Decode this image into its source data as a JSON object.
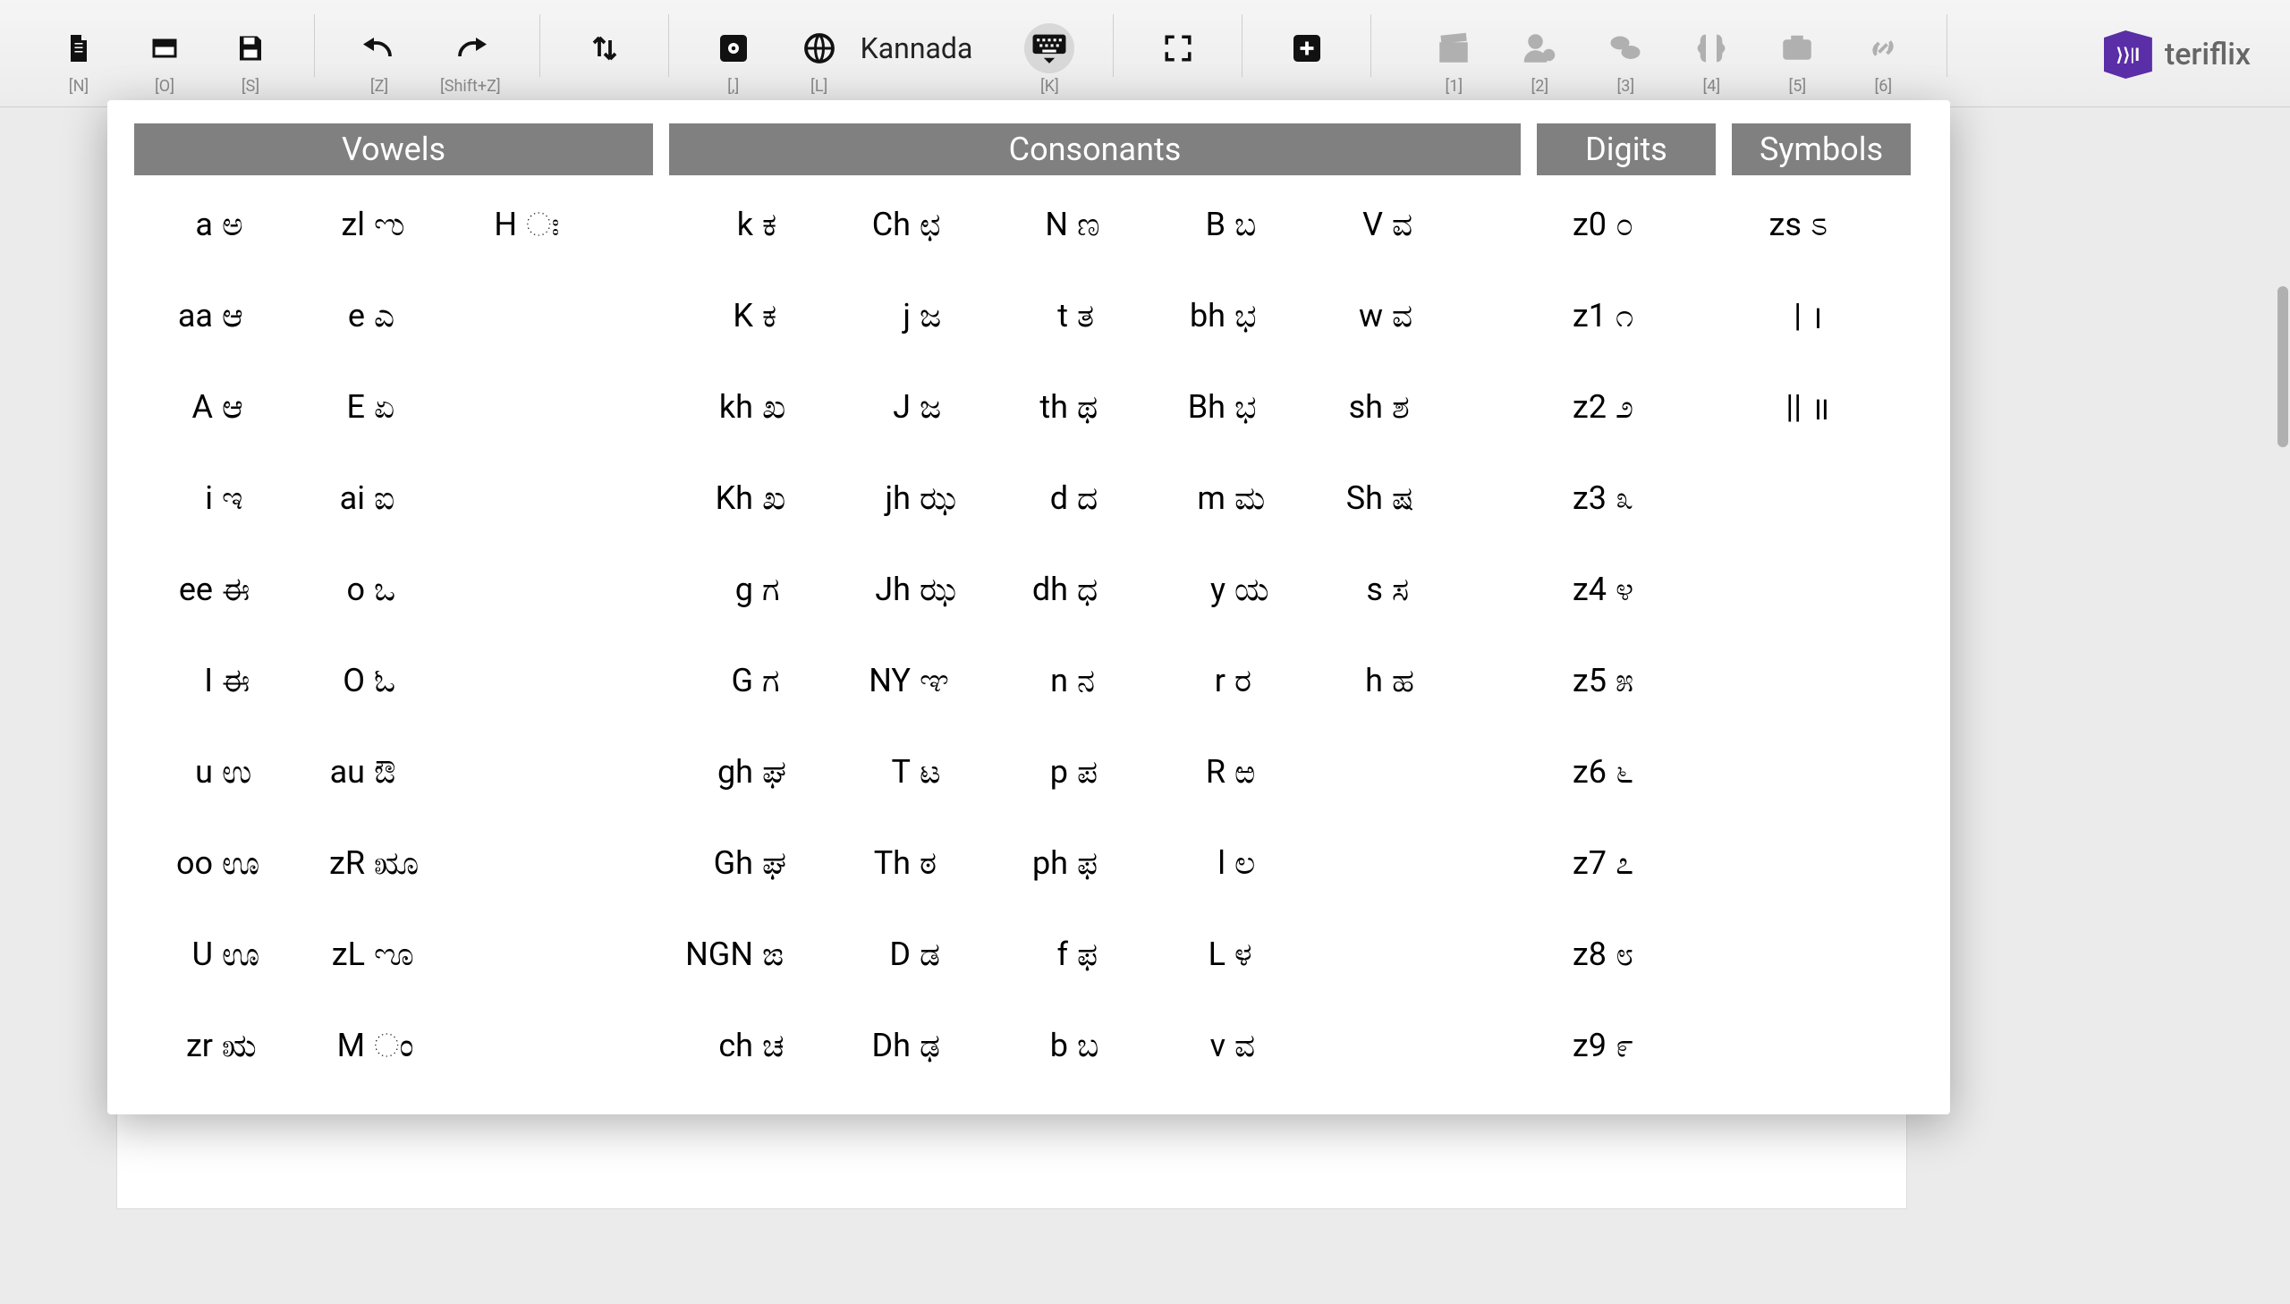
{
  "toolbar": {
    "new_sc": "[N]",
    "open_sc": "[O]",
    "save_sc": "[S]",
    "undo_sc": "[Z]",
    "redo_sc": "[Shift+Z]",
    "settings_sc": "[,]",
    "lang_label": "Kannada",
    "lang_sc": "[L]",
    "kbd_sc": "[K]",
    "slate_sc": "[1]",
    "user_sc": "[2]",
    "chat_sc": "[3]",
    "braces_sc": "[4]",
    "camera_sc": "[5]",
    "link_sc": "[6]"
  },
  "logo": {
    "text": "teriflix",
    "mark": "⟩⟩|I"
  },
  "headers": {
    "vowels": "Vowels",
    "consonants": "Consonants",
    "digits": "Digits",
    "symbols": "Symbols"
  },
  "vowels": {
    "col1": [
      {
        "l": "a",
        "g": "ಅ"
      },
      {
        "l": "aa",
        "g": "ಆ"
      },
      {
        "l": "A",
        "g": "ಆ"
      },
      {
        "l": "i",
        "g": "ಇ"
      },
      {
        "l": "ee",
        "g": "ಈ"
      },
      {
        "l": "I",
        "g": "ಈ"
      },
      {
        "l": "u",
        "g": "ಉ"
      },
      {
        "l": "oo",
        "g": "ಊ"
      },
      {
        "l": "U",
        "g": "ಊ"
      },
      {
        "l": "zr",
        "g": "ಋ"
      }
    ],
    "col2": [
      {
        "l": "zl",
        "g": "ಌ"
      },
      {
        "l": "e",
        "g": "ಎ"
      },
      {
        "l": "E",
        "g": "ಏ"
      },
      {
        "l": "ai",
        "g": "ಐ"
      },
      {
        "l": "o",
        "g": "ಒ"
      },
      {
        "l": "O",
        "g": "ಓ"
      },
      {
        "l": "au",
        "g": "ಔ"
      },
      {
        "l": "zR",
        "g": "ೠ"
      },
      {
        "l": "zL",
        "g": "ೡ"
      },
      {
        "l": "M",
        "g": "ಂ"
      }
    ],
    "col3": [
      {
        "l": "H",
        "g": "ಃ"
      }
    ]
  },
  "consonants": {
    "col1": [
      {
        "l": "k",
        "g": "ಕ"
      },
      {
        "l": "K",
        "g": "ಕ"
      },
      {
        "l": "kh",
        "g": "ಖ"
      },
      {
        "l": "Kh",
        "g": "ಖ"
      },
      {
        "l": "g",
        "g": "ಗ"
      },
      {
        "l": "G",
        "g": "ಗ"
      },
      {
        "l": "gh",
        "g": "ಘ"
      },
      {
        "l": "Gh",
        "g": "ಘ"
      },
      {
        "l": "NGN",
        "g": "ಙ"
      },
      {
        "l": "ch",
        "g": "ಚ"
      }
    ],
    "col2": [
      {
        "l": "Ch",
        "g": "ಛ"
      },
      {
        "l": "j",
        "g": "ಜ"
      },
      {
        "l": "J",
        "g": "ಜ"
      },
      {
        "l": "jh",
        "g": "ಝ"
      },
      {
        "l": "Jh",
        "g": "ಝ"
      },
      {
        "l": "NY",
        "g": "ಞ"
      },
      {
        "l": "T",
        "g": "ಟ"
      },
      {
        "l": "Th",
        "g": "ಠ"
      },
      {
        "l": "D",
        "g": "ಡ"
      },
      {
        "l": "Dh",
        "g": "ಢ"
      }
    ],
    "col3": [
      {
        "l": "N",
        "g": "ಣ"
      },
      {
        "l": "t",
        "g": "ತ"
      },
      {
        "l": "th",
        "g": "ಥ"
      },
      {
        "l": "d",
        "g": "ದ"
      },
      {
        "l": "dh",
        "g": "ಧ"
      },
      {
        "l": "n",
        "g": "ನ"
      },
      {
        "l": "p",
        "g": "ಪ"
      },
      {
        "l": "ph",
        "g": "ಫ"
      },
      {
        "l": "f",
        "g": "ಫ"
      },
      {
        "l": "b",
        "g": "ಬ"
      }
    ],
    "col4": [
      {
        "l": "B",
        "g": "ಬ"
      },
      {
        "l": "bh",
        "g": "ಭ"
      },
      {
        "l": "Bh",
        "g": "ಭ"
      },
      {
        "l": "m",
        "g": "ಮ"
      },
      {
        "l": "y",
        "g": "ಯ"
      },
      {
        "l": "r",
        "g": "ರ"
      },
      {
        "l": "R",
        "g": "ಱ"
      },
      {
        "l": "l",
        "g": "ಲ"
      },
      {
        "l": "L",
        "g": "ಳ"
      },
      {
        "l": "v",
        "g": "ವ"
      }
    ],
    "col5": [
      {
        "l": "V",
        "g": "ವ"
      },
      {
        "l": "w",
        "g": "ವ"
      },
      {
        "l": "sh",
        "g": "ಶ"
      },
      {
        "l": "Sh",
        "g": "ಷ"
      },
      {
        "l": "s",
        "g": "ಸ"
      },
      {
        "l": "h",
        "g": "ಹ"
      }
    ]
  },
  "digits": {
    "col1": [
      {
        "l": "z0",
        "g": "೦"
      },
      {
        "l": "z1",
        "g": "೧"
      },
      {
        "l": "z2",
        "g": "೨"
      },
      {
        "l": "z3",
        "g": "೩"
      },
      {
        "l": "z4",
        "g": "೪"
      },
      {
        "l": "z5",
        "g": "೫"
      },
      {
        "l": "z6",
        "g": "೬"
      },
      {
        "l": "z7",
        "g": "೭"
      },
      {
        "l": "z8",
        "g": "೮"
      },
      {
        "l": "z9",
        "g": "೯"
      }
    ]
  },
  "symbols": {
    "col1": [
      {
        "l": "zs",
        "g": "ಽ"
      },
      {
        "l": "|",
        "g": "।"
      },
      {
        "l": "||",
        "g": "॥"
      }
    ]
  }
}
